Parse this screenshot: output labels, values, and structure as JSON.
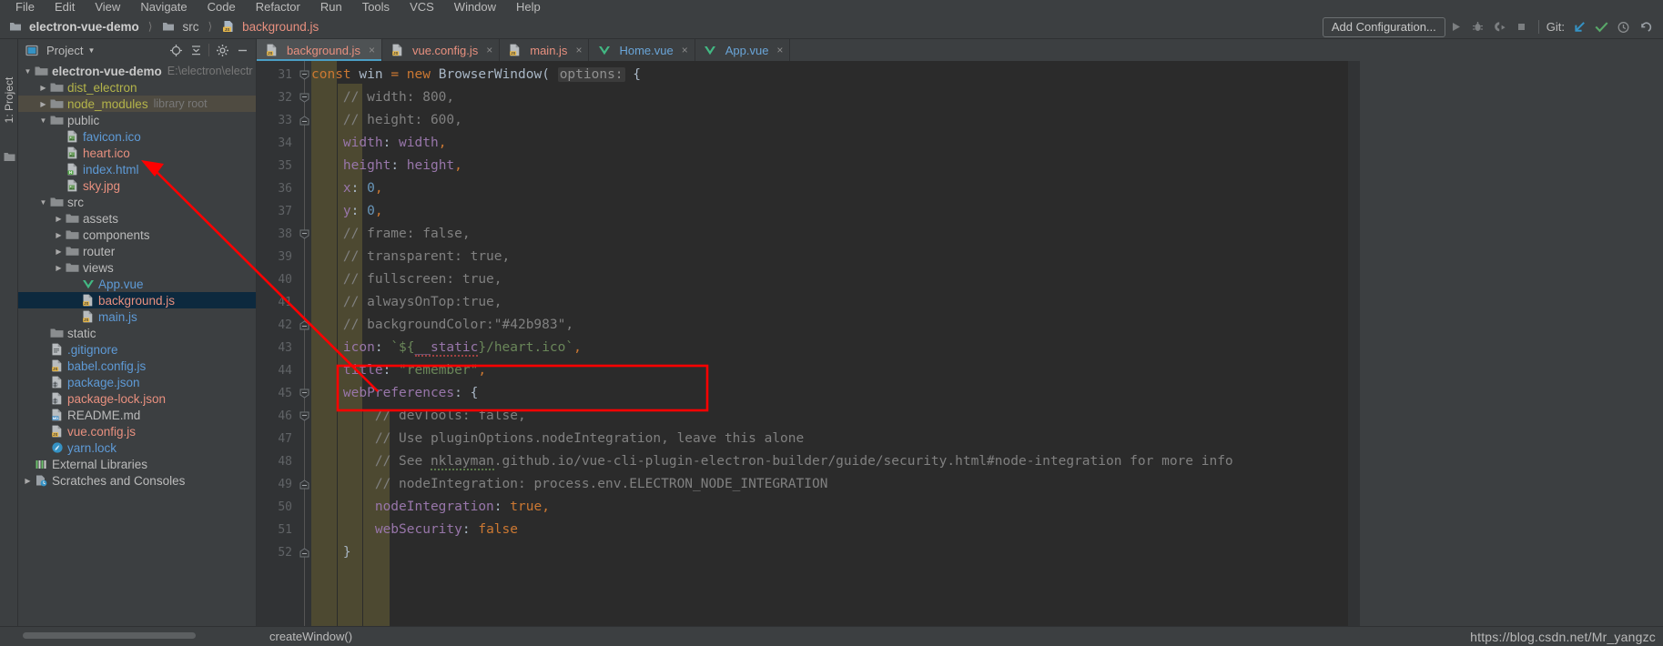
{
  "menubar": {
    "items": [
      "File",
      "Edit",
      "View",
      "Navigate",
      "Code",
      "Refactor",
      "Run",
      "Tools",
      "VCS",
      "Window",
      "Help"
    ]
  },
  "navbar": {
    "breadcrumb": [
      "electron-vue-demo",
      "src",
      "background.js"
    ],
    "add_configuration_label": "Add Configuration...",
    "git_label": "Git:",
    "icons": [
      "run-icon",
      "debug-icon",
      "run-with-coverage-icon",
      "stop-icon",
      "git-update-icon",
      "git-commit-icon",
      "git-history-icon",
      "git-revert-icon"
    ]
  },
  "tool_window": {
    "vertical_label": "1: Project"
  },
  "project_panel": {
    "title": "Project",
    "header_icons": [
      "locate-icon",
      "collapse-all-icon",
      "settings-icon",
      "hide-icon"
    ],
    "tree": [
      {
        "label": "electron-vue-demo",
        "sub": "E:\\electron\\electr",
        "icon": "folder-icon",
        "arrow": "down",
        "indent": 0,
        "style": "bold",
        "state": "normal"
      },
      {
        "label": "dist_electron",
        "sub": "",
        "icon": "folder-icon",
        "arrow": "right",
        "indent": 1,
        "style": "folder-y",
        "state": "normal"
      },
      {
        "label": "node_modules",
        "sub": "library root",
        "icon": "folder-icon",
        "arrow": "right",
        "indent": 1,
        "style": "folder-y",
        "state": "nm-highlight"
      },
      {
        "label": "public",
        "sub": "",
        "icon": "folder-icon",
        "arrow": "down",
        "indent": 1,
        "style": "plain",
        "state": "normal"
      },
      {
        "label": "favicon.ico",
        "sub": "",
        "icon": "image-file-icon",
        "arrow": "none",
        "indent": 2,
        "style": "file-b",
        "state": "normal"
      },
      {
        "label": "heart.ico",
        "sub": "",
        "icon": "image-file-icon",
        "arrow": "none",
        "indent": 2,
        "style": "file-r",
        "state": "normal"
      },
      {
        "label": "index.html",
        "sub": "",
        "icon": "html-file-icon",
        "arrow": "none",
        "indent": 2,
        "style": "file-b",
        "state": "normal"
      },
      {
        "label": "sky.jpg",
        "sub": "",
        "icon": "image-file-icon",
        "arrow": "none",
        "indent": 2,
        "style": "file-r",
        "state": "normal"
      },
      {
        "label": "src",
        "sub": "",
        "icon": "folder-icon",
        "arrow": "down",
        "indent": 1,
        "style": "plain",
        "state": "normal"
      },
      {
        "label": "assets",
        "sub": "",
        "icon": "folder-icon",
        "arrow": "right",
        "indent": 2,
        "style": "plain",
        "state": "normal"
      },
      {
        "label": "components",
        "sub": "",
        "icon": "folder-icon",
        "arrow": "right",
        "indent": 2,
        "style": "plain",
        "state": "normal"
      },
      {
        "label": "router",
        "sub": "",
        "icon": "folder-icon",
        "arrow": "right",
        "indent": 2,
        "style": "plain",
        "state": "normal"
      },
      {
        "label": "views",
        "sub": "",
        "icon": "folder-icon",
        "arrow": "right",
        "indent": 2,
        "style": "plain",
        "state": "normal"
      },
      {
        "label": "App.vue",
        "sub": "",
        "icon": "vue-file-icon",
        "arrow": "none",
        "indent": 3,
        "style": "file-b",
        "state": "normal"
      },
      {
        "label": "background.js",
        "sub": "",
        "icon": "js-file-icon",
        "arrow": "none",
        "indent": 3,
        "style": "file-r",
        "state": "selected"
      },
      {
        "label": "main.js",
        "sub": "",
        "icon": "js-file-icon",
        "arrow": "none",
        "indent": 3,
        "style": "file-b",
        "state": "normal"
      },
      {
        "label": "static",
        "sub": "",
        "icon": "folder-icon",
        "arrow": "none",
        "indent": 1,
        "style": "plain",
        "state": "normal"
      },
      {
        "label": ".gitignore",
        "sub": "",
        "icon": "text-file-icon",
        "arrow": "none",
        "indent": 1,
        "style": "file-b",
        "state": "normal"
      },
      {
        "label": "babel.config.js",
        "sub": "",
        "icon": "js-file-icon",
        "arrow": "none",
        "indent": 1,
        "style": "file-b",
        "state": "normal"
      },
      {
        "label": "package.json",
        "sub": "",
        "icon": "json-file-icon",
        "arrow": "none",
        "indent": 1,
        "style": "file-b",
        "state": "normal"
      },
      {
        "label": "package-lock.json",
        "sub": "",
        "icon": "json-file-icon",
        "arrow": "none",
        "indent": 1,
        "style": "file-r",
        "state": "normal"
      },
      {
        "label": "README.md",
        "sub": "",
        "icon": "md-file-icon",
        "arrow": "none",
        "indent": 1,
        "style": "plain",
        "state": "normal"
      },
      {
        "label": "vue.config.js",
        "sub": "",
        "icon": "js-file-icon",
        "arrow": "none",
        "indent": 1,
        "style": "file-r",
        "state": "normal"
      },
      {
        "label": "yarn.lock",
        "sub": "",
        "icon": "yarn-file-icon",
        "arrow": "none",
        "indent": 1,
        "style": "file-b",
        "state": "normal"
      },
      {
        "label": "External Libraries",
        "sub": "",
        "icon": "libraries-icon",
        "arrow": "none",
        "indent": 0,
        "style": "plain",
        "state": "normal"
      },
      {
        "label": "Scratches and Consoles",
        "sub": "",
        "icon": "scratches-icon",
        "arrow": "right",
        "indent": 0,
        "style": "plain",
        "state": "normal"
      }
    ]
  },
  "editor": {
    "tabs": [
      {
        "label": "background.js",
        "icon": "js-file-icon",
        "color": "js-r",
        "active": true
      },
      {
        "label": "vue.config.js",
        "icon": "js-file-icon",
        "color": "js-r",
        "active": false
      },
      {
        "label": "main.js",
        "icon": "js-file-icon",
        "color": "js-r",
        "active": false
      },
      {
        "label": "Home.vue",
        "icon": "vue-file-icon",
        "color": "js-b",
        "active": false
      },
      {
        "label": "App.vue",
        "icon": "vue-file-icon",
        "color": "js-b",
        "active": false
      }
    ],
    "first_line": 31,
    "line_numbers": [
      31,
      32,
      33,
      34,
      35,
      36,
      37,
      38,
      39,
      40,
      41,
      42,
      43,
      44,
      45,
      46,
      47,
      48,
      49,
      50,
      51,
      52
    ],
    "lines": [
      "const win = new BrowserWindow( options: {",
      "    // width: 800,",
      "    // height: 600,",
      "    width: width,",
      "    height: height,",
      "    x: 0,",
      "    y: 0,",
      "    // frame: false,",
      "    // transparent: true,",
      "    // fullscreen: true,",
      "    // alwaysOnTop:true,",
      "    // backgroundColor:\"#42b983\",",
      "    icon: `${__static}/heart.ico`,",
      "    title: \"remember\",",
      "    webPreferences: {",
      "        // devTools: false,",
      "        // Use pluginOptions.nodeIntegration, leave this alone",
      "        // See nklayman.github.io/vue-cli-plugin-electron-builder/guide/security.html#node-integration for more info",
      "        // nodeIntegration: process.env.ELECTRON_NODE_INTEGRATION",
      "        nodeIntegration: true,",
      "        webSecurity: false",
      "    }"
    ],
    "inlay_hint": "options:",
    "breadcrumb_function": "createWindow()"
  },
  "annotations": {
    "arrow_target": "heart.ico",
    "highlight_line": 43,
    "color": "#ff0000"
  },
  "watermark": "https://blog.csdn.net/Mr_yangzc",
  "colors": {
    "accent_tab_underline": "#4a9ec4",
    "selection": "#0d293e",
    "indent_band": "#4f4b31",
    "annotation_red": "#ff0000",
    "editor_bg": "#2b2b2b",
    "panel_bg": "#3c3f41"
  }
}
